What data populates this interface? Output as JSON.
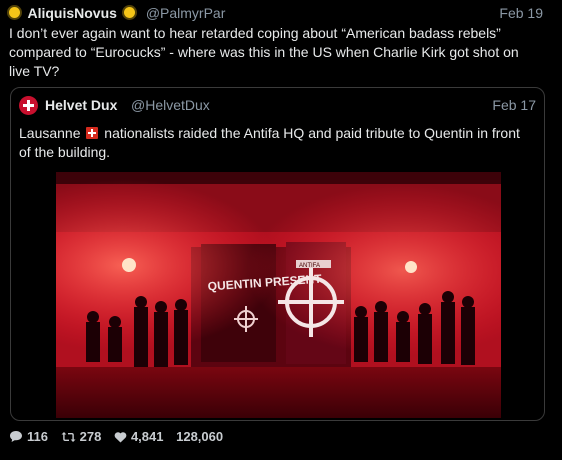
{
  "post": {
    "author_name": "AliquisNovus",
    "author_handle": "@PalmyrPar",
    "date": "Feb 19",
    "text": "I don’t ever again want to hear retarded coping about “American badass rebels” compared to “Eurocucks” - where was this in the US when Charlie Kirk got shot on live TV?"
  },
  "quote": {
    "author_name": "Helvet Dux",
    "author_handle": "@HelvetDux",
    "date": "Feb 17",
    "text_before_flag": "Lausanne",
    "text_after_flag": "nationalists raided the Antifa HQ and paid tribute to Quentin in front of the building.",
    "media_graffiti": "QUENTIN PRESENT",
    "media_sign": "ANTIFA"
  },
  "engagement": {
    "replies": "116",
    "reposts": "278",
    "likes": "4,841",
    "views": "128,060"
  },
  "colors": {
    "accent_sun": "#f5c518",
    "swiss_red": "#d52b1e",
    "flare_red": "#ff1a2e"
  },
  "icons": [
    "sun-emoji-icon",
    "swiss-flag-icon",
    "reply-icon",
    "repost-icon",
    "like-icon"
  ]
}
